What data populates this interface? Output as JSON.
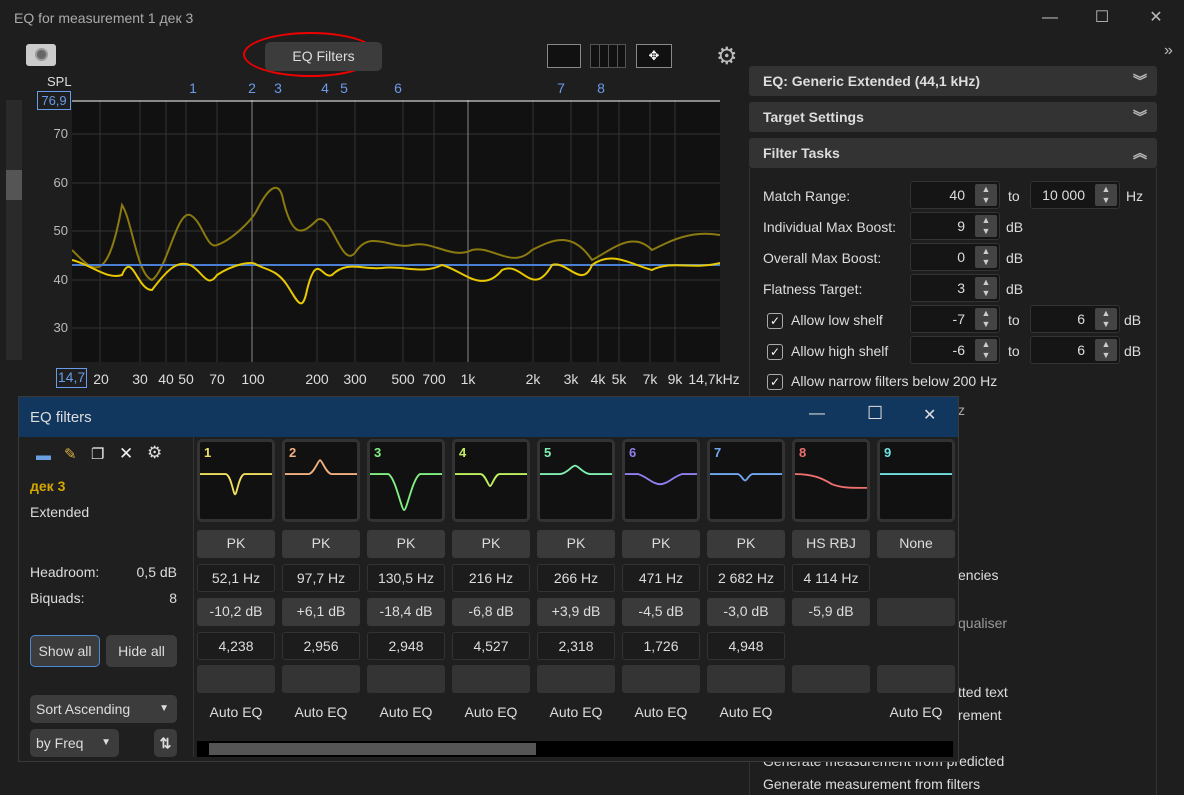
{
  "window": {
    "title": "EQ for measurement 1 дек 3",
    "minimize": "—",
    "maximize": "☐",
    "close": "✕"
  },
  "toolbar": {
    "eq_filters": "EQ Filters",
    "camera_icon": "camera-icon",
    "gear_icon": "gear-icon"
  },
  "graph": {
    "y_title": "SPL",
    "y_top": "76,9",
    "y_ticks": [
      "70",
      "60",
      "50",
      "40",
      "30"
    ],
    "x_start": "14,7",
    "x_ticks": [
      "20",
      "30",
      "40",
      "50",
      "70",
      "100",
      "200",
      "300",
      "500",
      "700",
      "1k",
      "2k",
      "3k",
      "4k",
      "5k",
      "7k",
      "9k",
      "14,7kHz"
    ],
    "filter_markers": [
      "1",
      "2",
      "3",
      "4",
      "5",
      "6",
      "7",
      "8"
    ],
    "colors": {
      "measurement": "#e8c800",
      "predicted": "#8a7a10",
      "target": "#4a7fd4"
    }
  },
  "right": {
    "collapse_icon": "»",
    "sections": [
      {
        "label": "EQ: Generic Extended (44,1 kHz)",
        "chev": "︾"
      },
      {
        "label": "Target Settings",
        "chev": "︾"
      },
      {
        "label": "Filter Tasks",
        "chev": "︽"
      }
    ],
    "match_range": {
      "label": "Match Range:",
      "from": "40",
      "to_label": "to",
      "to": "10 000",
      "unit": "Hz"
    },
    "individual_max_boost": {
      "label": "Individual Max Boost:",
      "value": "9",
      "unit": "dB"
    },
    "overall_max_boost": {
      "label": "Overall Max Boost:",
      "value": "0",
      "unit": "dB"
    },
    "flatness_target": {
      "label": "Flatness Target:",
      "value": "3",
      "unit": "dB"
    },
    "low_shelf": {
      "label": "Allow low shelf",
      "checked": true,
      "from": "-7",
      "to_label": "to",
      "to": "6",
      "unit": "dB"
    },
    "high_shelf": {
      "label": "Allow high shelf",
      "checked": true,
      "from": "-6",
      "to_label": "to",
      "to": "6",
      "unit": "dB"
    },
    "narrow": {
      "label": "Allow narrow filters below 200 Hz",
      "checked": true
    },
    "partial": [
      "z",
      "encies",
      "qualiser",
      "tted text",
      "rement",
      "Generate measurement from predicted",
      "Generate measurement from filters"
    ]
  },
  "dialog": {
    "title": "EQ filters",
    "minimize": "—",
    "maximize": "☐",
    "close": "✕",
    "name": "дек 3",
    "eq_type": "Extended",
    "headroom_label": "Headroom:",
    "headroom": "0,5 dB",
    "biquads_label": "Biquads:",
    "biquads": "8",
    "show_all": "Show all",
    "hide_all": "Hide all",
    "sort": "Sort Ascending",
    "by": "by Freq",
    "filters": [
      {
        "n": "1",
        "color": "#f0e060",
        "type": "PK",
        "freq": "52,1 Hz",
        "gain": "-10,2 dB",
        "q": "4,238",
        "auto": "Auto EQ"
      },
      {
        "n": "2",
        "color": "#f0b080",
        "type": "PK",
        "freq": "97,7 Hz",
        "gain": "+6,1 dB",
        "q": "2,956",
        "auto": "Auto EQ"
      },
      {
        "n": "3",
        "color": "#80f080",
        "type": "PK",
        "freq": "130,5 Hz",
        "gain": "-18,4 dB",
        "q": "2,948",
        "auto": "Auto EQ"
      },
      {
        "n": "4",
        "color": "#c0f060",
        "type": "PK",
        "freq": "216 Hz",
        "gain": "-6,8 dB",
        "q": "4,527",
        "auto": "Auto EQ"
      },
      {
        "n": "5",
        "color": "#80f0b0",
        "type": "PK",
        "freq": "266 Hz",
        "gain": "+3,9 dB",
        "q": "2,318",
        "auto": "Auto EQ"
      },
      {
        "n": "6",
        "color": "#9080f0",
        "type": "PK",
        "freq": "471 Hz",
        "gain": "-4,5 dB",
        "q": "1,726",
        "auto": "Auto EQ"
      },
      {
        "n": "7",
        "color": "#70a8f0",
        "type": "PK",
        "freq": "2 682 Hz",
        "gain": "-3,0 dB",
        "q": "4,948",
        "auto": "Auto EQ"
      },
      {
        "n": "8",
        "color": "#f07070",
        "type": "HS RBJ",
        "freq": "4 114 Hz",
        "gain": "-5,9 dB",
        "q": "",
        "auto": ""
      },
      {
        "n": "9",
        "color": "#70e0e0",
        "type": "None",
        "freq": "",
        "gain": "",
        "q": "",
        "auto": "Auto EQ"
      }
    ]
  }
}
